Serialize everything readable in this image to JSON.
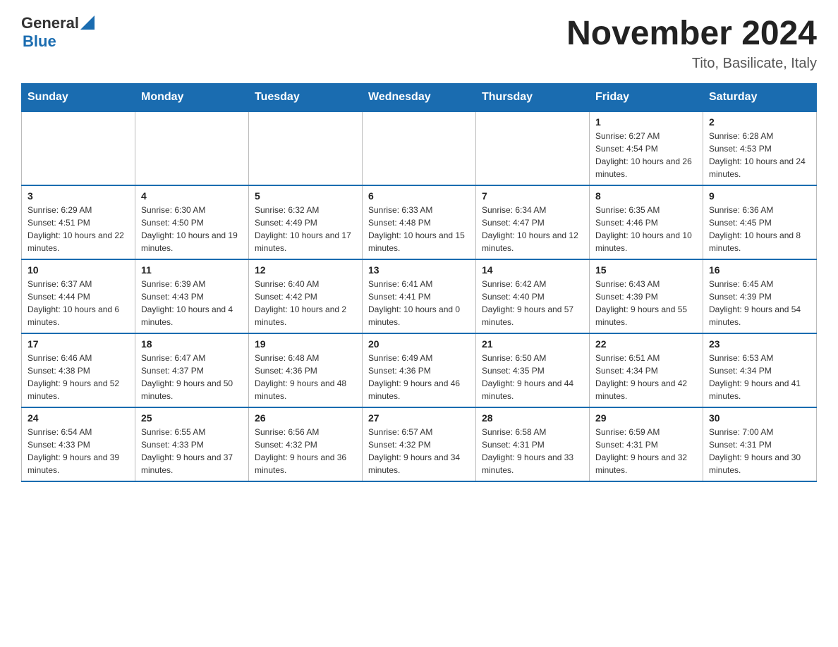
{
  "header": {
    "logo_general": "General",
    "logo_blue": "Blue",
    "title": "November 2024",
    "subtitle": "Tito, Basilicate, Italy"
  },
  "days_of_week": [
    "Sunday",
    "Monday",
    "Tuesday",
    "Wednesday",
    "Thursday",
    "Friday",
    "Saturday"
  ],
  "weeks": [
    [
      {
        "day": "",
        "info": ""
      },
      {
        "day": "",
        "info": ""
      },
      {
        "day": "",
        "info": ""
      },
      {
        "day": "",
        "info": ""
      },
      {
        "day": "",
        "info": ""
      },
      {
        "day": "1",
        "info": "Sunrise: 6:27 AM\nSunset: 4:54 PM\nDaylight: 10 hours and 26 minutes."
      },
      {
        "day": "2",
        "info": "Sunrise: 6:28 AM\nSunset: 4:53 PM\nDaylight: 10 hours and 24 minutes."
      }
    ],
    [
      {
        "day": "3",
        "info": "Sunrise: 6:29 AM\nSunset: 4:51 PM\nDaylight: 10 hours and 22 minutes."
      },
      {
        "day": "4",
        "info": "Sunrise: 6:30 AM\nSunset: 4:50 PM\nDaylight: 10 hours and 19 minutes."
      },
      {
        "day": "5",
        "info": "Sunrise: 6:32 AM\nSunset: 4:49 PM\nDaylight: 10 hours and 17 minutes."
      },
      {
        "day": "6",
        "info": "Sunrise: 6:33 AM\nSunset: 4:48 PM\nDaylight: 10 hours and 15 minutes."
      },
      {
        "day": "7",
        "info": "Sunrise: 6:34 AM\nSunset: 4:47 PM\nDaylight: 10 hours and 12 minutes."
      },
      {
        "day": "8",
        "info": "Sunrise: 6:35 AM\nSunset: 4:46 PM\nDaylight: 10 hours and 10 minutes."
      },
      {
        "day": "9",
        "info": "Sunrise: 6:36 AM\nSunset: 4:45 PM\nDaylight: 10 hours and 8 minutes."
      }
    ],
    [
      {
        "day": "10",
        "info": "Sunrise: 6:37 AM\nSunset: 4:44 PM\nDaylight: 10 hours and 6 minutes."
      },
      {
        "day": "11",
        "info": "Sunrise: 6:39 AM\nSunset: 4:43 PM\nDaylight: 10 hours and 4 minutes."
      },
      {
        "day": "12",
        "info": "Sunrise: 6:40 AM\nSunset: 4:42 PM\nDaylight: 10 hours and 2 minutes."
      },
      {
        "day": "13",
        "info": "Sunrise: 6:41 AM\nSunset: 4:41 PM\nDaylight: 10 hours and 0 minutes."
      },
      {
        "day": "14",
        "info": "Sunrise: 6:42 AM\nSunset: 4:40 PM\nDaylight: 9 hours and 57 minutes."
      },
      {
        "day": "15",
        "info": "Sunrise: 6:43 AM\nSunset: 4:39 PM\nDaylight: 9 hours and 55 minutes."
      },
      {
        "day": "16",
        "info": "Sunrise: 6:45 AM\nSunset: 4:39 PM\nDaylight: 9 hours and 54 minutes."
      }
    ],
    [
      {
        "day": "17",
        "info": "Sunrise: 6:46 AM\nSunset: 4:38 PM\nDaylight: 9 hours and 52 minutes."
      },
      {
        "day": "18",
        "info": "Sunrise: 6:47 AM\nSunset: 4:37 PM\nDaylight: 9 hours and 50 minutes."
      },
      {
        "day": "19",
        "info": "Sunrise: 6:48 AM\nSunset: 4:36 PM\nDaylight: 9 hours and 48 minutes."
      },
      {
        "day": "20",
        "info": "Sunrise: 6:49 AM\nSunset: 4:36 PM\nDaylight: 9 hours and 46 minutes."
      },
      {
        "day": "21",
        "info": "Sunrise: 6:50 AM\nSunset: 4:35 PM\nDaylight: 9 hours and 44 minutes."
      },
      {
        "day": "22",
        "info": "Sunrise: 6:51 AM\nSunset: 4:34 PM\nDaylight: 9 hours and 42 minutes."
      },
      {
        "day": "23",
        "info": "Sunrise: 6:53 AM\nSunset: 4:34 PM\nDaylight: 9 hours and 41 minutes."
      }
    ],
    [
      {
        "day": "24",
        "info": "Sunrise: 6:54 AM\nSunset: 4:33 PM\nDaylight: 9 hours and 39 minutes."
      },
      {
        "day": "25",
        "info": "Sunrise: 6:55 AM\nSunset: 4:33 PM\nDaylight: 9 hours and 37 minutes."
      },
      {
        "day": "26",
        "info": "Sunrise: 6:56 AM\nSunset: 4:32 PM\nDaylight: 9 hours and 36 minutes."
      },
      {
        "day": "27",
        "info": "Sunrise: 6:57 AM\nSunset: 4:32 PM\nDaylight: 9 hours and 34 minutes."
      },
      {
        "day": "28",
        "info": "Sunrise: 6:58 AM\nSunset: 4:31 PM\nDaylight: 9 hours and 33 minutes."
      },
      {
        "day": "29",
        "info": "Sunrise: 6:59 AM\nSunset: 4:31 PM\nDaylight: 9 hours and 32 minutes."
      },
      {
        "day": "30",
        "info": "Sunrise: 7:00 AM\nSunset: 4:31 PM\nDaylight: 9 hours and 30 minutes."
      }
    ]
  ]
}
